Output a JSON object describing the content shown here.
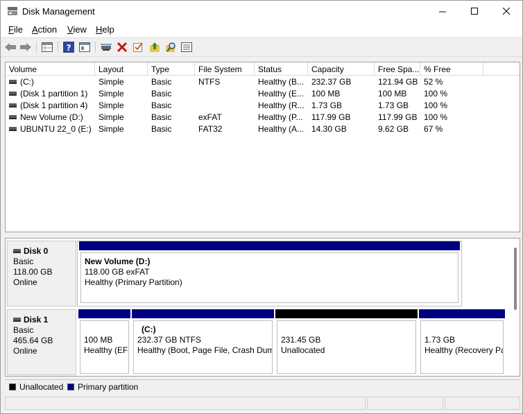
{
  "window": {
    "title": "Disk Management"
  },
  "menu": [
    "File",
    "Action",
    "View",
    "Help"
  ],
  "toolbar_icons": [
    "back-arrow-icon",
    "forward-arrow-icon",
    "properties-grid-icon",
    "help-icon",
    "show-hide-pane-icon",
    "connect-disk-icon",
    "delete-icon",
    "check-icon",
    "up-folder-icon",
    "search-folder-icon",
    "list-icon"
  ],
  "volume_table": {
    "columns": [
      "Volume",
      "Layout",
      "Type",
      "File System",
      "Status",
      "Capacity",
      "Free Spa...",
      "% Free"
    ],
    "rows": [
      [
        "(C:)",
        "Simple",
        "Basic",
        "NTFS",
        "Healthy (B...",
        "232.37 GB",
        "121.94 GB",
        "52 %"
      ],
      [
        "(Disk 1 partition 1)",
        "Simple",
        "Basic",
        "",
        "Healthy (E...",
        "100 MB",
        "100 MB",
        "100 %"
      ],
      [
        "(Disk 1 partition 4)",
        "Simple",
        "Basic",
        "",
        "Healthy (R...",
        "1.73 GB",
        "1.73 GB",
        "100 %"
      ],
      [
        "New Volume (D:)",
        "Simple",
        "Basic",
        "exFAT",
        "Healthy (P...",
        "117.99 GB",
        "117.99 GB",
        "100 %"
      ],
      [
        "UBUNTU 22_0 (E:)",
        "Simple",
        "Basic",
        "FAT32",
        "Healthy (A...",
        "14.30 GB",
        "9.62 GB",
        "67 %"
      ]
    ]
  },
  "disks": [
    {
      "name": "Disk 0",
      "type": "Basic",
      "size": "118.00 GB",
      "state": "Online",
      "partitions": [
        {
          "name": "New Volume  (D:)",
          "line2": "118.00 GB exFAT",
          "line3": "Healthy (Primary Partition)",
          "bar_color": "#00007f"
        }
      ]
    },
    {
      "name": "Disk 1",
      "type": "Basic",
      "size": "465.64 GB",
      "state": "Online",
      "partitions": [
        {
          "name": "",
          "line2": "100 MB",
          "line3": "Healthy (EF",
          "bar_color": "#00007f"
        },
        {
          "name": "(C:)",
          "line2": "232.37 GB NTFS",
          "line3": "Healthy (Boot, Page File, Crash Dum",
          "bar_color": "#00007f"
        },
        {
          "name": "",
          "line2": "231.45 GB",
          "line3": "Unallocated",
          "bar_color": "#000000"
        },
        {
          "name": "",
          "line2": "1.73 GB",
          "line3": "Healthy (Recovery Pa",
          "bar_color": "#00007f"
        }
      ]
    }
  ],
  "legend": [
    {
      "label": "Unallocated",
      "color": "#000000"
    },
    {
      "label": "Primary partition",
      "color": "#00007f"
    }
  ]
}
